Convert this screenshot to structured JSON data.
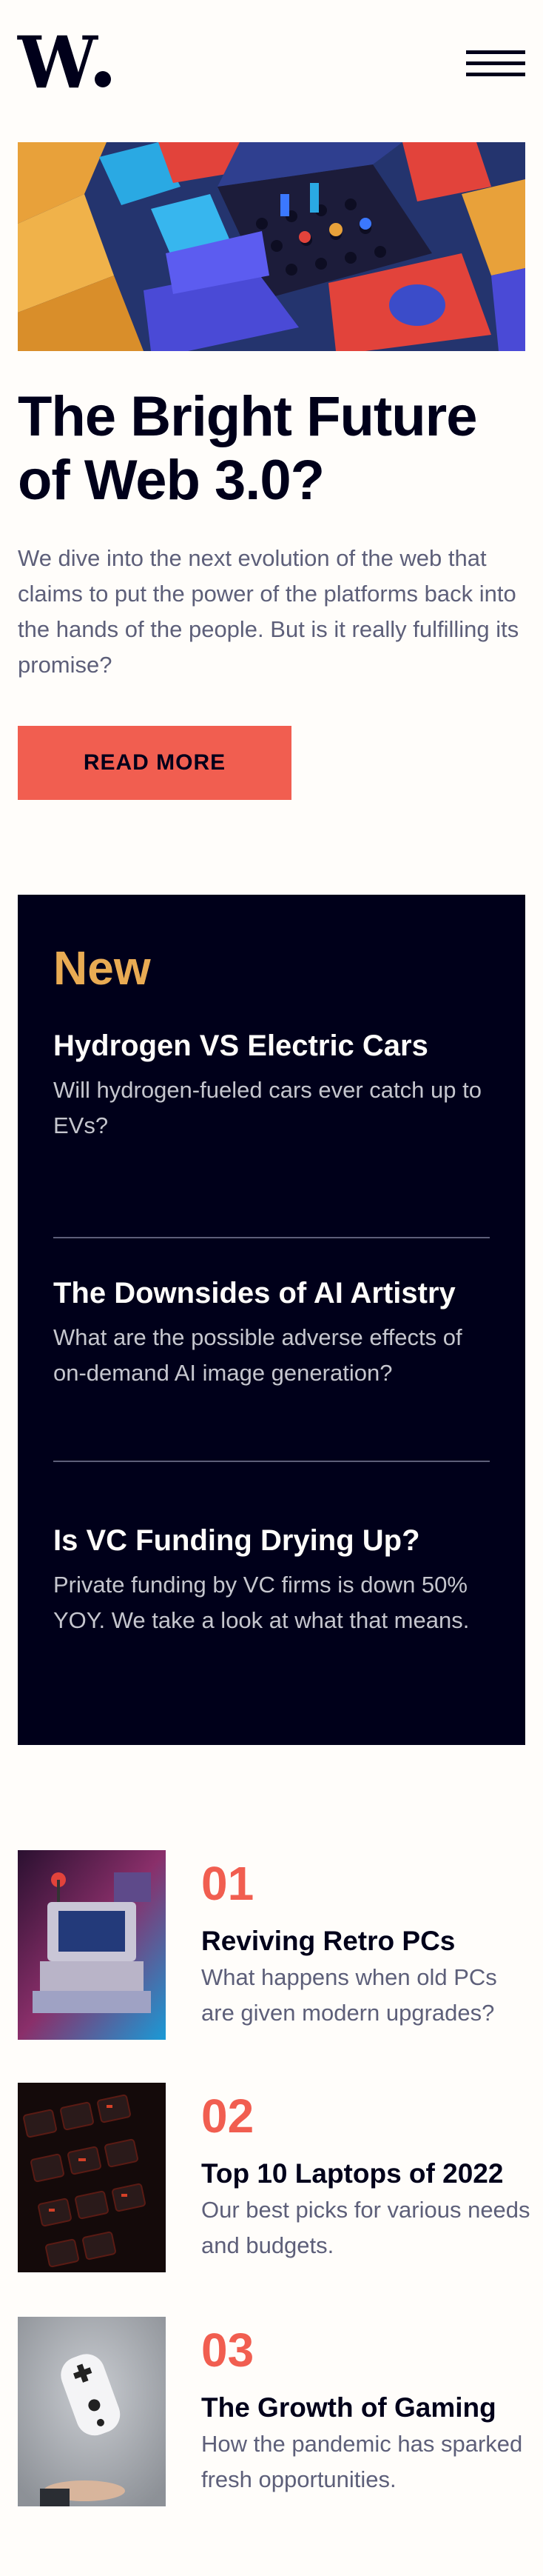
{
  "header": {
    "logo_text": "W",
    "menu_label": "Menu"
  },
  "hero": {
    "image_alt": "Colorful 3D geometric shapes",
    "title": "The Bright Future of Web 3.0?",
    "description": "We dive into the next evolution of the web that claims to put the power of the platforms back into the hands of the people. But is it really fulfilling its promise?",
    "cta_label": "READ MORE"
  },
  "new_section": {
    "heading": "New",
    "items": [
      {
        "title": "Hydrogen VS Electric Cars",
        "description": "Will hydrogen-fueled cars ever catch up to EVs?"
      },
      {
        "title": "The Downsides of AI Artistry",
        "description": "What are the possible adverse effects of on-demand AI image generation?"
      },
      {
        "title": "Is VC Funding Drying Up?",
        "description": "Private funding by VC firms is down 50% YOY. We take a look at what that means."
      }
    ]
  },
  "articles": [
    {
      "number": "01",
      "title": "Reviving Retro PCs",
      "description": "What happens when old PCs are given modern upgrades?"
    },
    {
      "number": "02",
      "title": "Top 10 Laptops of 2022",
      "description": "Our best picks for various needs and budgets."
    },
    {
      "number": "03",
      "title": "The Growth of Gaming",
      "description": "How the pandemic has sparked fresh opportunities."
    }
  ],
  "colors": {
    "background": "#fffdfa",
    "dark": "#00001a",
    "accent_red": "#f15e50",
    "accent_orange": "#e9ab53",
    "muted_text": "#5d5f79"
  }
}
